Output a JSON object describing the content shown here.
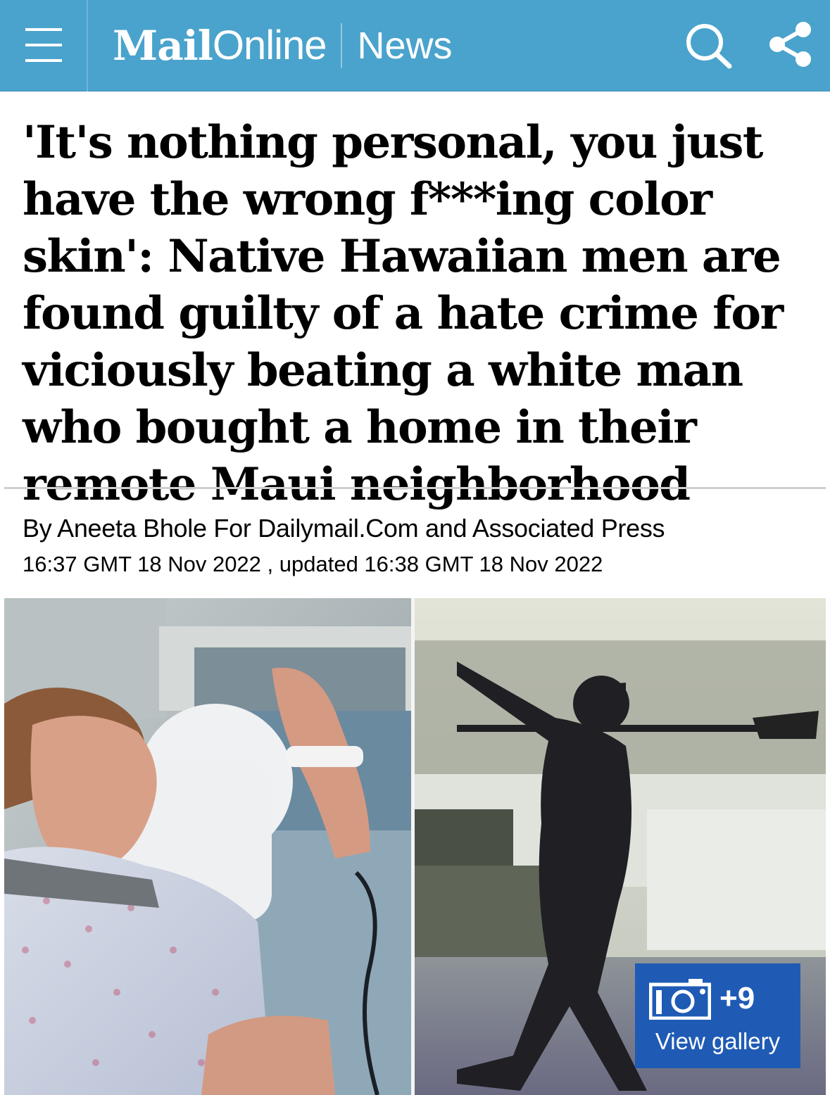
{
  "header": {
    "logo_mail": "Mail",
    "logo_online": "Online",
    "section": "News",
    "menu_icon": "hamburger-icon",
    "search_icon": "search-icon",
    "share_icon": "share-icon",
    "bar_color": "#4aa3cc"
  },
  "article": {
    "headline": "'It's nothing personal, you just have the wrong f***ing color skin': Native Hawaiian men are found guilty of a hate crime for viciously beating a white man who bought a home in their remote Maui neighborhood",
    "byline": "By Aneeta Bhole For Dailymail.Com and Associated Press",
    "timestamp": "16:37 GMT 18 Nov 2022 , updated 16:38 GMT 18 Nov 2022"
  },
  "gallery": {
    "count": "+9",
    "label": "View gallery",
    "icon": "camera-icon",
    "color": "#1f5bb5"
  }
}
